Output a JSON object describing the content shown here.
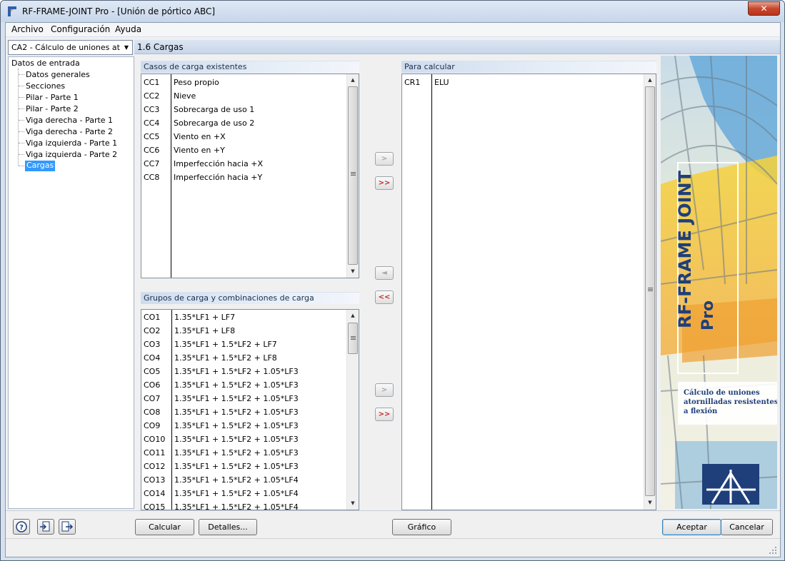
{
  "window": {
    "title": "RF-FRAME-JOINT Pro - [Unión de pórtico ABC]",
    "close_label": "✕"
  },
  "menu": [
    "Archivo",
    "Configuración",
    "Ayuda"
  ],
  "case_selector": {
    "value": "CA2 - Cálculo de uniones atorni"
  },
  "tree": {
    "root": "Datos de entrada",
    "items": [
      "Datos generales",
      "Secciones",
      "Pilar - Parte 1",
      "Pilar - Parte 2",
      "Viga derecha - Parte 1",
      "Viga derecha - Parte 2",
      "Viga izquierda - Parte 1",
      "Viga izquierda - Parte 2",
      "Cargas"
    ],
    "selected_index": 8
  },
  "section_title": "1.6 Cargas",
  "existing_cases": {
    "header": "Casos de carga existentes",
    "rows": [
      [
        "CC1",
        "Peso propio"
      ],
      [
        "CC2",
        "Nieve"
      ],
      [
        "CC3",
        "Sobrecarga de uso 1"
      ],
      [
        "CC4",
        "Sobrecarga de uso 2"
      ],
      [
        "CC5",
        "Viento en +X"
      ],
      [
        "CC6",
        "Viento en +Y"
      ],
      [
        "CC7",
        "Imperfección hacia +X"
      ],
      [
        "CC8",
        "Imperfección hacia +Y"
      ]
    ]
  },
  "combinations": {
    "header": "Grupos de carga y combinaciones de carga",
    "rows": [
      [
        "CO1",
        "1.35*LF1 + LF7"
      ],
      [
        "CO2",
        "1.35*LF1 + LF8"
      ],
      [
        "CO3",
        "1.35*LF1 + 1.5*LF2 + LF7"
      ],
      [
        "CO4",
        "1.35*LF1 + 1.5*LF2 + LF8"
      ],
      [
        "CO5",
        "1.35*LF1 + 1.5*LF2 + 1.05*LF3"
      ],
      [
        "CO6",
        "1.35*LF1 + 1.5*LF2 + 1.05*LF3"
      ],
      [
        "CO7",
        "1.35*LF1 + 1.5*LF2 + 1.05*LF3"
      ],
      [
        "CO8",
        "1.35*LF1 + 1.5*LF2 + 1.05*LF3"
      ],
      [
        "CO9",
        "1.35*LF1 + 1.5*LF2 + 1.05*LF3"
      ],
      [
        "CO10",
        "1.35*LF1 + 1.5*LF2 + 1.05*LF3"
      ],
      [
        "CO11",
        "1.35*LF1 + 1.5*LF2 + 1.05*LF3"
      ],
      [
        "CO12",
        "1.35*LF1 + 1.5*LF2 + 1.05*LF3"
      ],
      [
        "CO13",
        "1.35*LF1 + 1.5*LF2 + 1.05*LF4"
      ],
      [
        "CO14",
        "1.35*LF1 + 1.5*LF2 + 1.05*LF4"
      ],
      [
        "CO15",
        "1.35*LF1 + 1.5*LF2 + 1.05*LF4"
      ]
    ]
  },
  "to_calculate": {
    "header": "Para calcular",
    "rows": [
      [
        "CR1",
        "ELU"
      ]
    ]
  },
  "transfer_buttons": {
    "add_one": ">",
    "add_all": ">>",
    "remove_one": "◄",
    "remove_all": "<<"
  },
  "side_image": {
    "product_name": "RF-FRAME JOINT",
    "product_suffix": "Pro",
    "caption_line1": "Cálculo de uniones",
    "caption_line2": "atornilladas resistentes",
    "caption_line3": "a flexión"
  },
  "buttons": {
    "calcular": "Calcular",
    "detalles": "Detalles...",
    "grafico": "Gráfico",
    "aceptar": "Aceptar",
    "cancelar": "Cancelar"
  },
  "colors": {
    "selection": "#3399ff",
    "accent_red": "#c52b2b",
    "logo_blue": "#1f3f7a"
  }
}
